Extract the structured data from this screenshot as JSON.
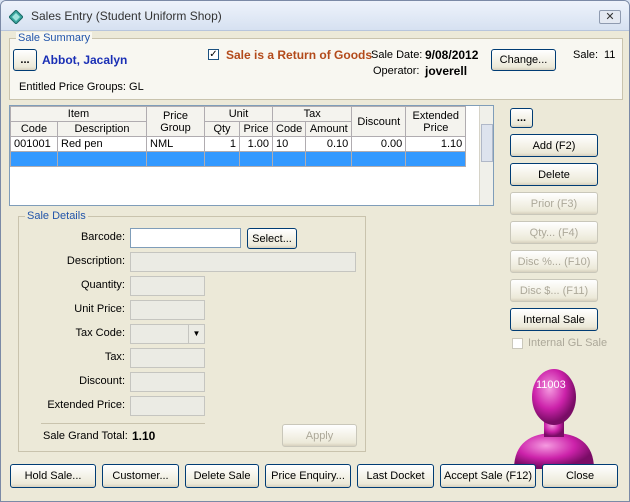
{
  "window": {
    "title": "Sales Entry (Student Uniform Shop)",
    "close_glyph": "✕"
  },
  "summary": {
    "legend": "Sale Summary",
    "customer_picker_label": "...",
    "customer_name": "Abbot, Jacalyn",
    "entitled_groups": "Entitled Price Groups: GL",
    "return_checkbox_checked": true,
    "return_label": "Sale is a Return of Goods",
    "sale_date_label": "Sale Date:",
    "sale_date_value": "9/08/2012",
    "operator_label": "Operator:",
    "operator_value": "joverell",
    "change_button": "Change...",
    "sale_label": "Sale:",
    "sale_value": "11"
  },
  "grid": {
    "headers": {
      "item": "Item",
      "code": "Code",
      "description": "Description",
      "price_group": "Price Group",
      "unit": "Unit",
      "qty": "Qty",
      "price": "Price",
      "tax": "Tax",
      "tax_code": "Code",
      "amount": "Amount",
      "discount": "Discount",
      "extended_price": "Extended Price"
    },
    "rows": [
      {
        "code": "001001",
        "description": "Red pen",
        "price_group": "NML",
        "qty": "1",
        "price": "1.00",
        "tax_code": "10",
        "amount": "0.10",
        "discount": "0.00",
        "extended_price": "1.10"
      }
    ]
  },
  "side_buttons": {
    "more": "...",
    "add": "Add (F2)",
    "delete": "Delete",
    "prior": "Prior (F3)",
    "qty": "Qty... (F4)",
    "disc_pct": "Disc %... (F10)",
    "disc_dollar": "Disc $... (F11)",
    "internal_sale": "Internal Sale",
    "internal_gl_sale": "Internal GL Sale"
  },
  "avatar_number": "11003",
  "details": {
    "legend": "Sale Details",
    "barcode_label": "Barcode:",
    "select_button": "Select...",
    "description_label": "Description:",
    "quantity_label": "Quantity:",
    "unit_price_label": "Unit Price:",
    "tax_code_label": "Tax Code:",
    "tax_label": "Tax:",
    "discount_label": "Discount:",
    "extended_price_label": "Extended Price:",
    "grand_total_label": "Sale Grand Total:",
    "grand_total_value": "1.10",
    "apply_button": "Apply"
  },
  "bottom_buttons": {
    "hold_sale": "Hold Sale...",
    "customer": "Customer...",
    "delete_sale": "Delete Sale",
    "price_enquiry": "Price Enquiry...",
    "last_docket": "Last Docket",
    "accept_sale": "Accept Sale (F12)",
    "close": "Close"
  },
  "colors": {
    "customer_name": "#1a2fb5",
    "return_label": "#b34a1a",
    "legend": "#2255aa",
    "selection": "#3399ff",
    "avatar": "#cc22aa"
  }
}
